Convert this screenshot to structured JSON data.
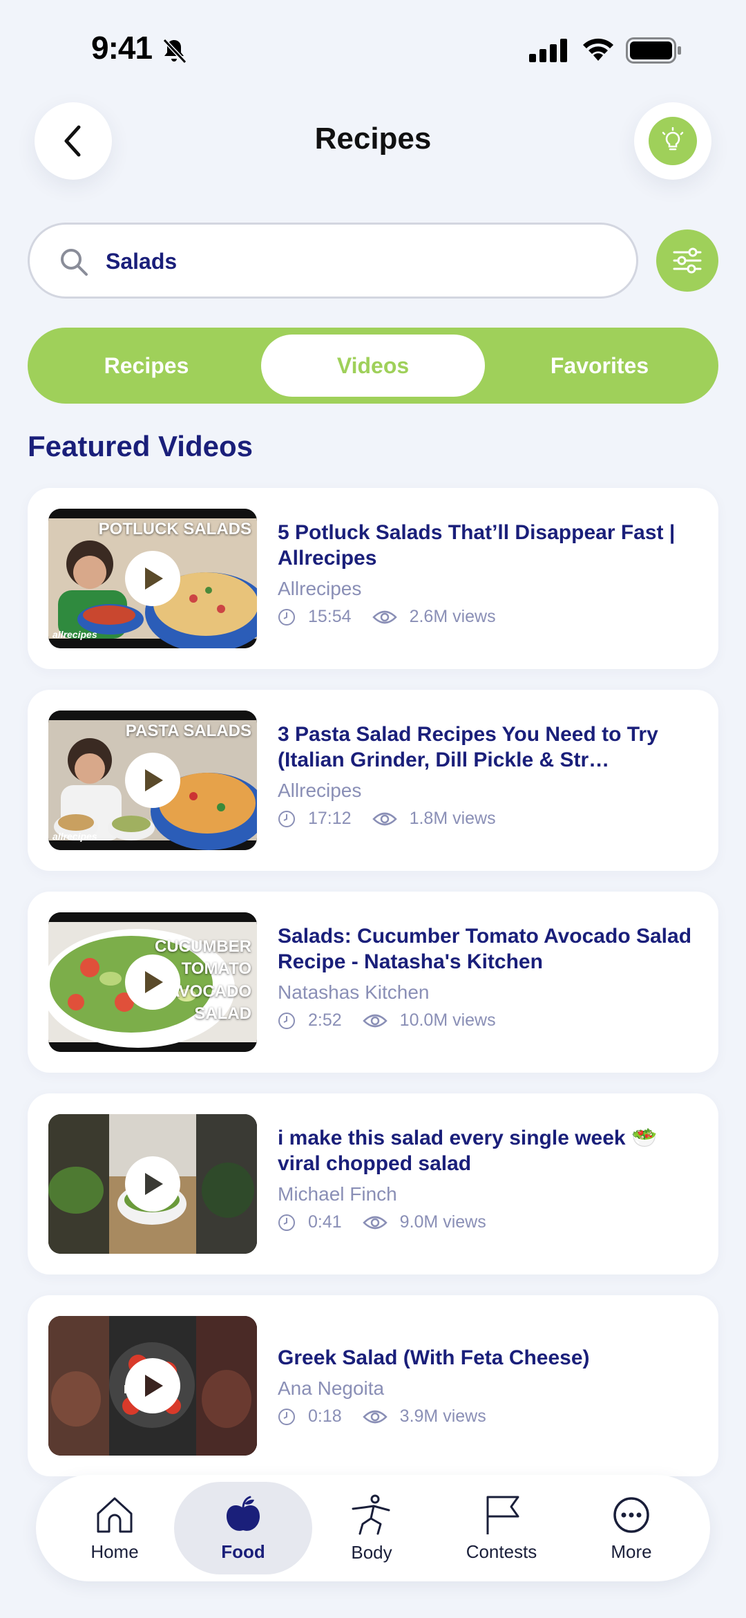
{
  "status_bar": {
    "time": "9:41"
  },
  "header": {
    "title": "Recipes"
  },
  "search": {
    "value": "Salads"
  },
  "tabs": [
    {
      "label": "Recipes"
    },
    {
      "label": "Videos",
      "active": true
    },
    {
      "label": "Favorites"
    }
  ],
  "section_title": "Featured Videos",
  "videos": [
    {
      "title": "5 Potluck Salads That’ll Disappear Fast | Allrecipes",
      "channel": "Allrecipes",
      "duration": "15:54",
      "views": "2.6M views",
      "thumb_caption": "POTLUCK SALADS",
      "thumb_brand": "allrecipes"
    },
    {
      "title": "3 Pasta Salad Recipes You Need to Try (Italian Grinder, Dill Pickle & Str…",
      "channel": "Allrecipes",
      "duration": "17:12",
      "views": "1.8M views",
      "thumb_caption": "PASTA SALADS",
      "thumb_brand": "allrecipes"
    },
    {
      "title": "Salads: Cucumber Tomato Avocado Salad Recipe - Natasha's Kitchen",
      "channel": "Natashas Kitchen",
      "duration": "2:52",
      "views": "10.0M views",
      "thumb_caption": "CUCUMBER TOMATO AVOCADO SALAD"
    },
    {
      "title": "i make this salad every single week 🥗 viral chopped salad",
      "channel": "Michael Finch",
      "duration": "0:41",
      "views": "9.0M views"
    },
    {
      "title": "Greek Salad (With Feta Cheese)",
      "channel": "Ana Negoita",
      "duration": "0:18",
      "views": "3.9M views"
    }
  ],
  "nav": [
    {
      "label": "Home",
      "icon": "home-icon"
    },
    {
      "label": "Food",
      "icon": "apple-icon",
      "active": true
    },
    {
      "label": "Body",
      "icon": "body-icon"
    },
    {
      "label": "Contests",
      "icon": "flag-icon"
    },
    {
      "label": "More",
      "icon": "more-icon"
    }
  ],
  "colors": {
    "accent": "#9fd05a",
    "primary_text": "#1a1f7a",
    "muted_text": "#8a8fb6",
    "background": "#f1f4fa"
  }
}
